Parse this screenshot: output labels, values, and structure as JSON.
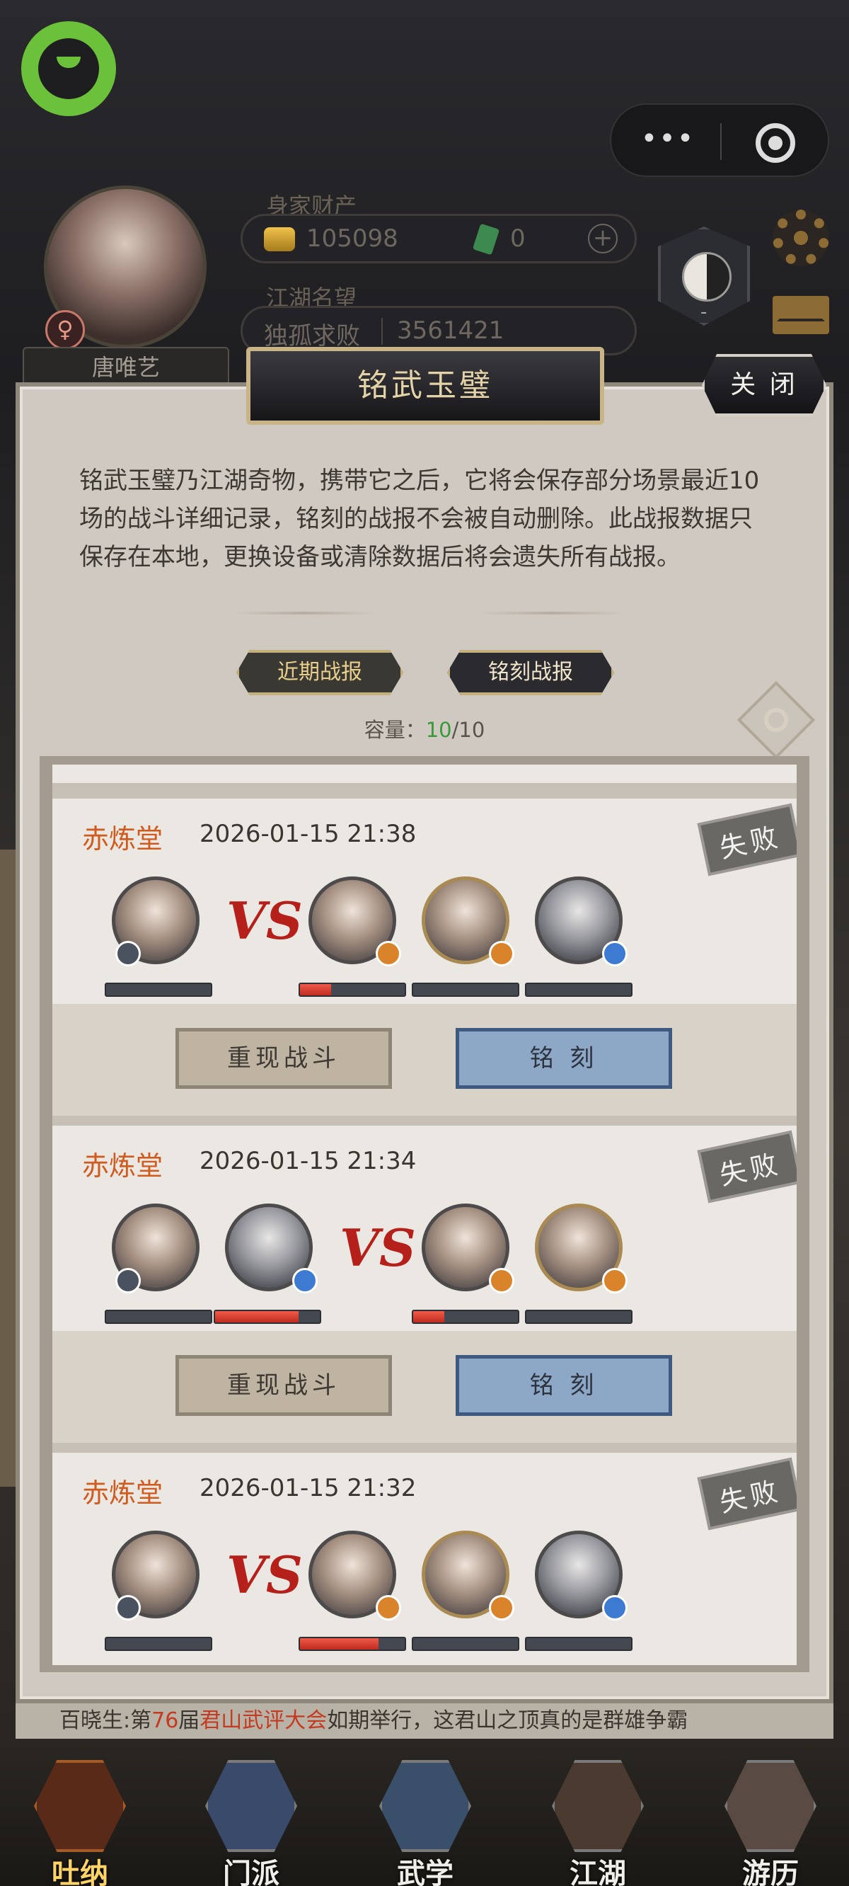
{
  "header": {
    "wealth_label": "身家财产",
    "silver": "105098",
    "jade": "0",
    "plus": "+",
    "reputation_label": "江湖名望",
    "reputation_title": "独孤求败",
    "reputation_value": "3561421",
    "player_name": "唐唯艺",
    "gender_symbol": "♀",
    "sect_rank": "-"
  },
  "capsule": {
    "more": "•••"
  },
  "panel": {
    "title": "铭武玉璧",
    "close": "关 闭",
    "description": "铭武玉璧乃江湖奇物，携带它之后，它将会保存部分场景最近10场的战斗详细记录，铭刻的战报不会被自动删除。此战报数据只保存在本地，更换设备或清除数据后将会遗失所有战报。",
    "tabs": [
      "近期战报",
      "铭刻战报"
    ],
    "capacity_label": "容量：",
    "capacity_used": "10",
    "capacity_total": "/10"
  },
  "battles": [
    {
      "hall": "赤炼堂",
      "time": "2026-01-15 21:38",
      "result": "失败",
      "vs": "VS",
      "left_hp": [
        0
      ],
      "right_hp": [
        0.3,
        0,
        0
      ],
      "replay": "重现战斗",
      "engrave": "铭 刻"
    },
    {
      "hall": "赤炼堂",
      "time": "2026-01-15 21:34",
      "result": "失败",
      "vs": "VS",
      "left_hp": [
        0,
        0.8
      ],
      "right_hp": [
        0.3,
        0
      ],
      "replay": "重现战斗",
      "engrave": "铭 刻"
    },
    {
      "hall": "赤炼堂",
      "time": "2026-01-15 21:32",
      "result": "失败",
      "vs": "VS",
      "left_hp": [
        0
      ],
      "right_hp": [
        0.75,
        0,
        0
      ],
      "replay": "重现战斗",
      "engrave": "铭 刻"
    }
  ],
  "ticker": {
    "prefix": "百晓生:第",
    "number": "76",
    "mid": "届",
    "event": "君山武评大会",
    "suffix": "如期举行，这君山之顶真的是群雄争霸"
  },
  "nav": [
    {
      "label": "吐纳",
      "icon": "gourd-icon",
      "active": true
    },
    {
      "label": "门派",
      "icon": "sect-flag-icon",
      "active": false
    },
    {
      "label": "武学",
      "icon": "scroll-books-icon",
      "active": false
    },
    {
      "label": "江湖",
      "icon": "straw-hat-icon",
      "active": false
    },
    {
      "label": "游历",
      "icon": "horse-icon",
      "active": false
    }
  ],
  "colors": {
    "hall_text": "#cf5b1f",
    "vs_text": "#b6201a",
    "hp_fill": "#d9352a",
    "capacity_used": "#3a9a3a",
    "engrave_button": "#8da8c7"
  }
}
